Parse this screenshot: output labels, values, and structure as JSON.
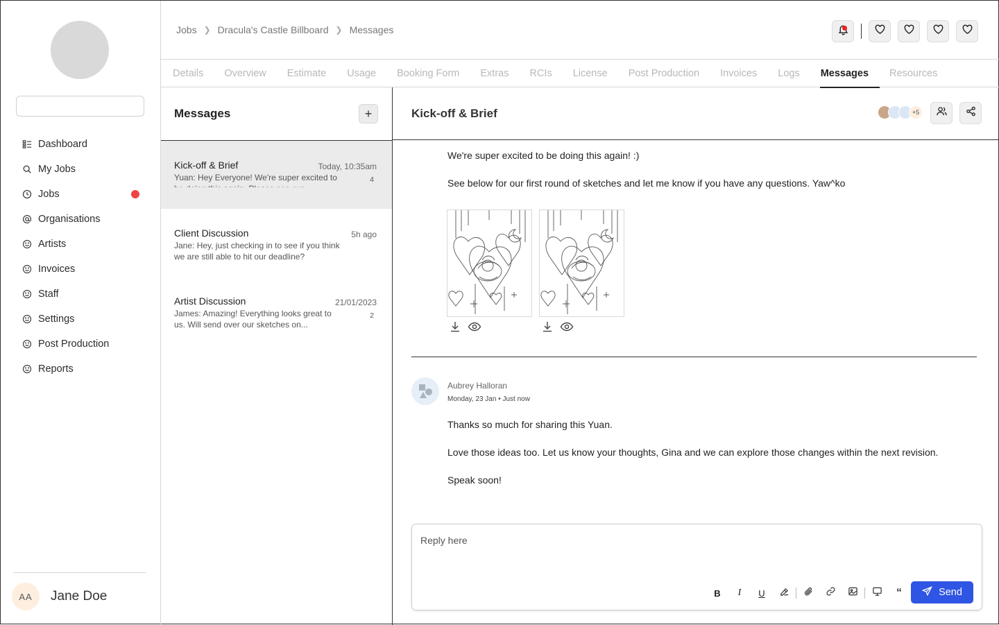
{
  "sidebar": {
    "search_placeholder": "",
    "items": [
      {
        "label": "Dashboard",
        "icon": "dashboard-icon"
      },
      {
        "label": "My Jobs",
        "icon": "search-icon"
      },
      {
        "label": "Jobs",
        "icon": "clock-icon",
        "badge": true
      },
      {
        "label": "Organisations",
        "icon": "at-icon"
      },
      {
        "label": "Artists",
        "icon": "smiley-icon"
      },
      {
        "label": "Invoices",
        "icon": "smiley-icon"
      },
      {
        "label": "Staff",
        "icon": "smiley-icon"
      },
      {
        "label": "Settings",
        "icon": "smiley-icon"
      },
      {
        "label": "Post Production",
        "icon": "smiley-icon"
      },
      {
        "label": "Reports",
        "icon": "smiley-icon"
      }
    ],
    "user": {
      "initials": "AA",
      "name": "Jane Doe"
    }
  },
  "breadcrumb": [
    "Jobs",
    "Dracula's Castle Billboard",
    "Messages"
  ],
  "tabs": [
    "Details",
    "Overview",
    "Estimate",
    "Usage",
    "Booking Form",
    "Extras",
    "RCIs",
    "License",
    "Post Production",
    "Invoices",
    "Logs",
    "Messages",
    "Resources"
  ],
  "active_tab": "Messages",
  "messages_panel": {
    "title": "Messages",
    "threads": [
      {
        "title": "Kick-off & Brief",
        "time": "Today, 10:35am",
        "preview": "Yuan: Hey Everyone! We're super excited to be doing this again. Please see our...",
        "count": "4"
      },
      {
        "title": "Client Discussion",
        "time": "5h ago",
        "preview": "Jane: Hey, just checking in to see if you think we are still able to hit our deadline?",
        "count": ""
      },
      {
        "title": "Artist Discussion",
        "time": "21/01/2023",
        "preview": "James: Amazing! Everything looks great to us. Will send over our sketches on...",
        "count": "2"
      }
    ]
  },
  "conversation": {
    "title": "Kick-off & Brief",
    "members_more": "+5",
    "first_message": {
      "line1": "We're super excited to be doing this again! :)",
      "line2": "See below for our first round of sketches and let me know if you have any questions. Yaw^ko"
    },
    "second_message": {
      "sender": "Aubrey Halloran",
      "date": "Monday, 23 Jan • Just now",
      "line1": "Thanks so much for sharing this Yuan.",
      "line2": "Love those ideas too. Let us know your thoughts, Gina and we can explore those changes within the next revision.",
      "line3": "Speak soon!"
    },
    "reply_placeholder": "Reply here",
    "send_label": "Send"
  },
  "colors": {
    "accent": "#2f55e4",
    "badge": "#ef4444"
  }
}
